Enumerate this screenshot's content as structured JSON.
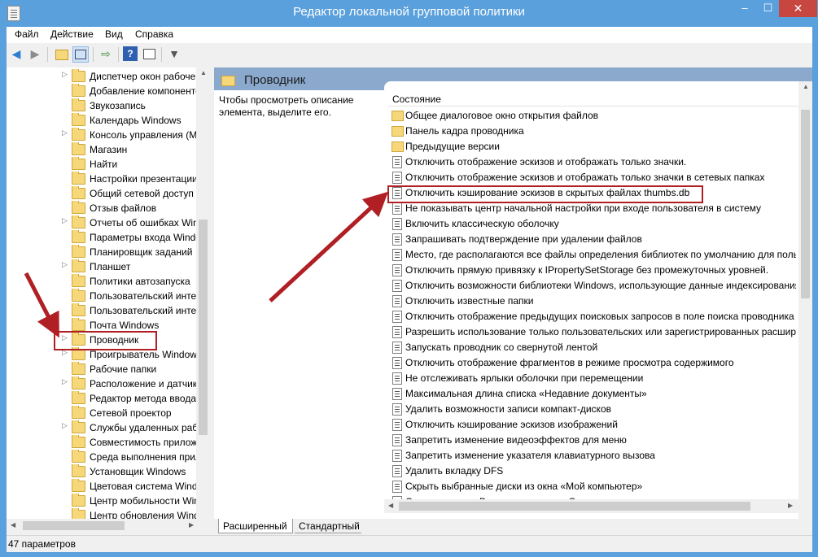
{
  "window": {
    "title": "Редактор локальной групповой политики"
  },
  "titlebar_buttons": {
    "minimize": "–",
    "maximize": "☐",
    "close": "✕"
  },
  "menu": [
    "Файл",
    "Действие",
    "Вид",
    "Справка"
  ],
  "toolbar": {
    "back": "◀",
    "forward": "▶"
  },
  "tree": {
    "items": [
      {
        "label": "Диспетчер окон рабочего стола",
        "arrow": true
      },
      {
        "label": "Добавление компонентов Windows",
        "arrow": false
      },
      {
        "label": "Звукозапись",
        "arrow": false
      },
      {
        "label": "Календарь Windows",
        "arrow": false
      },
      {
        "label": "Консоль управления (MMC)",
        "arrow": true
      },
      {
        "label": "Магазин",
        "arrow": false
      },
      {
        "label": "Найти",
        "arrow": false
      },
      {
        "label": "Настройки презентации",
        "arrow": false
      },
      {
        "label": "Общий сетевой доступ",
        "arrow": false
      },
      {
        "label": "Отзыв файлов",
        "arrow": false
      },
      {
        "label": "Отчеты об ошибках Windows",
        "arrow": true
      },
      {
        "label": "Параметры входа Windows",
        "arrow": false
      },
      {
        "label": "Планировщик заданий",
        "arrow": false
      },
      {
        "label": "Планшет",
        "arrow": true
      },
      {
        "label": "Политики автозапуска",
        "arrow": false
      },
      {
        "label": "Пользовательский интерфейс",
        "arrow": false
      },
      {
        "label": "Пользовательский интерфейс",
        "arrow": false
      },
      {
        "label": "Почта Windows",
        "arrow": false
      },
      {
        "label": "Проводник",
        "arrow": true
      },
      {
        "label": "Проигрыватель Windows Media",
        "arrow": true
      },
      {
        "label": "Рабочие папки",
        "arrow": false
      },
      {
        "label": "Расположение и датчики",
        "arrow": true
      },
      {
        "label": "Редактор метода ввода",
        "arrow": false
      },
      {
        "label": "Сетевой проектор",
        "arrow": false
      },
      {
        "label": "Службы удаленных рабочих столов",
        "arrow": true
      },
      {
        "label": "Совместимость приложений",
        "arrow": false
      },
      {
        "label": "Среда выполнения приложений",
        "arrow": false
      },
      {
        "label": "Установщик Windows",
        "arrow": false
      },
      {
        "label": "Цветовая система Windows",
        "arrow": false
      },
      {
        "label": "Центр мобильности Windows",
        "arrow": false
      },
      {
        "label": "Центр обновления Windows",
        "arrow": false
      }
    ]
  },
  "right": {
    "header_title": "Проводник",
    "description": "Чтобы просмотреть описание элемента, выделите его.",
    "column_header": "Состояние",
    "items": [
      {
        "label": "Общее диалоговое окно открытия файлов",
        "type": "folder"
      },
      {
        "label": "Панель кадра проводника",
        "type": "folder"
      },
      {
        "label": "Предыдущие версии",
        "type": "folder"
      },
      {
        "label": "Отключить отображение эскизов и отображать только значки.",
        "type": "setting"
      },
      {
        "label": "Отключить отображение эскизов и отображать только значки в сетевых папках",
        "type": "setting"
      },
      {
        "label": "Отключить кэширование эскизов в скрытых файлах thumbs.db",
        "type": "setting"
      },
      {
        "label": "Не показывать центр начальной настройки при входе пользователя в систему",
        "type": "setting"
      },
      {
        "label": "Включить классическую оболочку",
        "type": "setting"
      },
      {
        "label": "Запрашивать подтверждение при удалении файлов",
        "type": "setting"
      },
      {
        "label": "Место, где располагаются все файлы определения библиотек по умолчанию для пользователей",
        "type": "setting"
      },
      {
        "label": "Отключить прямую привязку к IPropertySetStorage без промежуточных уровней.",
        "type": "setting"
      },
      {
        "label": "Отключить возможности библиотеки Windows, использующие данные индексирования.",
        "type": "setting"
      },
      {
        "label": "Отключить известные папки",
        "type": "setting"
      },
      {
        "label": "Отключить отображение предыдущих поисковых запросов в поле поиска проводника",
        "type": "setting"
      },
      {
        "label": "Разрешить использование только пользовательских или зарегистрированных расширений",
        "type": "setting"
      },
      {
        "label": "Запускать проводник со свернутой лентой",
        "type": "setting"
      },
      {
        "label": "Отключить отображение фрагментов в режиме просмотра содержимого",
        "type": "setting"
      },
      {
        "label": "Не отслеживать ярлыки оболочки при перемещении",
        "type": "setting"
      },
      {
        "label": "Максимальная длина списка «Недавние документы»",
        "type": "setting"
      },
      {
        "label": "Удалить возможности записи компакт-дисков",
        "type": "setting"
      },
      {
        "label": "Отключить кэширование эскизов изображений",
        "type": "setting"
      },
      {
        "label": "Запретить изменение видеоэффектов для меню",
        "type": "setting"
      },
      {
        "label": "Запретить изменение указателя клавиатурного вызова",
        "type": "setting"
      },
      {
        "label": "Удалить вкладку DFS",
        "type": "setting"
      },
      {
        "label": "Скрыть выбранные диски из окна «Мой компьютер»",
        "type": "setting"
      },
      {
        "label": "Скрыть значок «Вся сеть» в папке «Сеть»",
        "type": "setting"
      }
    ]
  },
  "tabs": [
    "Расширенный",
    "Стандартный"
  ],
  "status": "47 параметров",
  "colors": {
    "titlebar": "#5aa0dc",
    "close": "#c7463f",
    "highlight": "#b01f24",
    "header_band": "#8aa9cd"
  }
}
